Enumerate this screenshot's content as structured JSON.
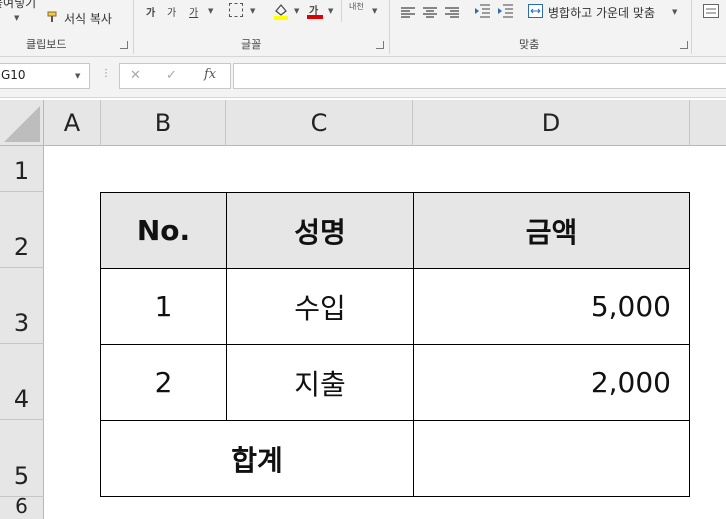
{
  "ribbon": {
    "clipboard": {
      "paste_partial": "붙여넣기",
      "format_painter": "서식 복사",
      "group_label": "클립보드"
    },
    "font": {
      "grow_font": "가",
      "shrink_font": "가",
      "underline": "가",
      "font_color_glyph": "가",
      "group_label": "글꼴",
      "highlight_color": "#ffff00",
      "font_color": "#e00000"
    },
    "alignment": {
      "wrap_partial": "내천",
      "merge_center": "병합하고 가운데 맞춤",
      "group_label": "맞춤"
    }
  },
  "formula_bar": {
    "name_box": "G10",
    "cancel_icon": "✕",
    "enter_icon": "✓",
    "fx_label": "fx",
    "formula_value": ""
  },
  "sheet": {
    "columns": [
      "A",
      "B",
      "C",
      "D"
    ],
    "rows": [
      "1",
      "2",
      "3",
      "4",
      "5",
      "6"
    ],
    "table": {
      "headers": [
        "No.",
        "성명",
        "금액"
      ],
      "rows": [
        [
          "1",
          "수입",
          "5,000"
        ],
        [
          "2",
          "지출",
          "2,000"
        ]
      ],
      "total_label": "합계",
      "total_value": "",
      "header_fill": "#e7e6e6"
    }
  }
}
